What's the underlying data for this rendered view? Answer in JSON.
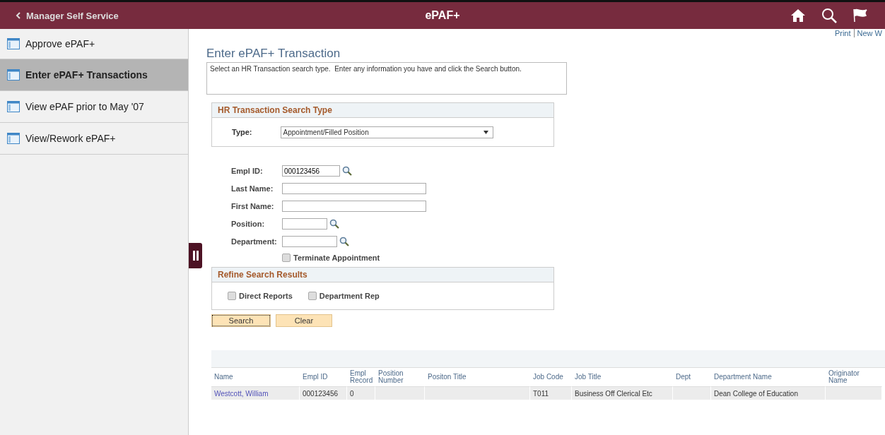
{
  "header": {
    "back_label": "Manager Self Service",
    "title": "ePAF+"
  },
  "sidebar": {
    "items": [
      {
        "label": "Approve ePAF+",
        "selected": false
      },
      {
        "label": "Enter ePAF+ Transactions",
        "selected": true
      },
      {
        "label": "View ePAF prior to May '07",
        "selected": false
      },
      {
        "label": "View/Rework ePAF+",
        "selected": false
      }
    ]
  },
  "top_links": [
    "Print",
    "New W"
  ],
  "page_title": "Enter ePAF+ Transaction",
  "instructions": "Select an HR Transaction search type.  Enter any information you have and click the Search button.",
  "search_type": {
    "title": "HR Transaction Search Type",
    "label": "Type:",
    "value": "Appointment/Filled Position"
  },
  "fields": [
    {
      "label": "Empl ID:",
      "value": "000123456",
      "lookup": true
    },
    {
      "label": "Last Name:",
      "lookup": false
    },
    {
      "label": "First Name:",
      "lookup": false
    },
    {
      "label": "Position:",
      "lookup": true
    },
    {
      "label": "Department:",
      "lookup": true
    }
  ],
  "terminate": {
    "label": "Terminate Appointment",
    "checked": false
  },
  "refine": {
    "title": "Refine Search Results",
    "options": [
      {
        "label": "Direct Reports",
        "checked": false
      },
      {
        "label": "Department Rep",
        "checked": false
      }
    ]
  },
  "buttons": [
    {
      "label": "Search",
      "focused": true
    },
    {
      "label": "Clear",
      "focused": false
    }
  ],
  "table": {
    "columns": [
      "Name",
      "Empl ID",
      "Empl Record",
      "Position Number",
      "Positon Title",
      "Job Code",
      "Job Title",
      "Dept",
      "Department Name",
      "Originator Name"
    ],
    "rows": [
      [
        "Westcott, William",
        "000123456",
        "0",
        "",
        "",
        "T011",
        "Business Off Clerical Etc",
        "",
        "Dean College of Education",
        ""
      ]
    ]
  }
}
